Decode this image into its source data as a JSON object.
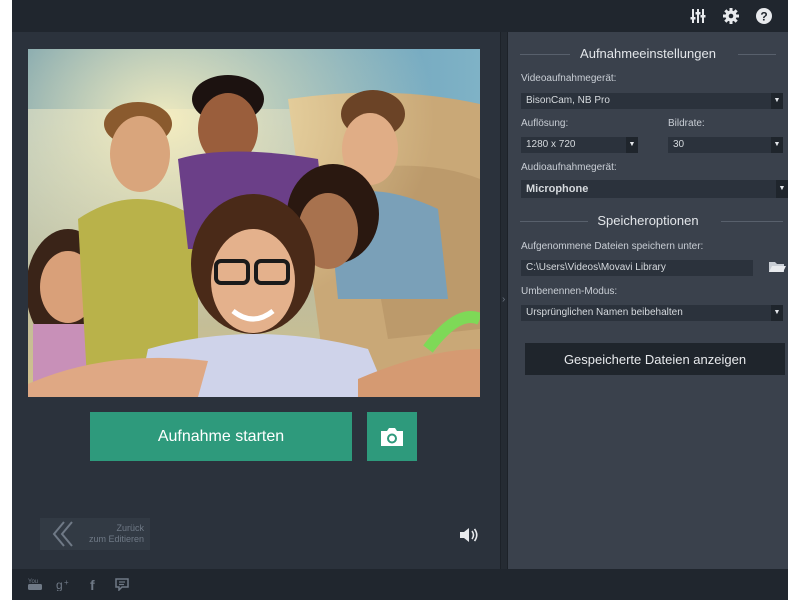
{
  "topbar": {
    "icons": [
      "equalizer-icon",
      "gear-icon",
      "help-icon"
    ]
  },
  "capture": {
    "record_label": "Aufnahme starten",
    "snapshot_icon": "camera-icon",
    "back_label_line1": "Zurück",
    "back_label_line2": "zum Editieren",
    "back_icon": "double-chevron-left-icon",
    "sound_icon": "speaker-icon"
  },
  "settings": {
    "recording_title": "Aufnahmeeinstellungen",
    "video_device_label": "Videoaufnahmegerät:",
    "video_device_value": "BisonCam, NB Pro",
    "resolution_label": "Auflösung:",
    "resolution_value": "1280 x 720",
    "framerate_label": "Bildrate:",
    "framerate_value": "30",
    "audio_device_label": "Audioaufnahmegerät:",
    "audio_device_value": "Microphone",
    "storage_title": "Speicheroptionen",
    "save_to_label": "Aufgenommene Dateien speichern unter:",
    "save_to_value": "C:\\Users\\Videos\\Movavi Library",
    "rename_label": "Umbenennen-Modus:",
    "rename_value": "Ursprünglichen Namen beibehalten",
    "show_files_label": "Gespeicherte Dateien anzeigen"
  },
  "footer": {
    "icons": [
      "youtube-icon",
      "google-plus-icon",
      "facebook-icon",
      "feedback-icon"
    ]
  },
  "colors": {
    "accent": "#2e9a7c",
    "panel_dark": "#2b323c",
    "panel_right": "#3a414c",
    "bar": "#20262e"
  }
}
